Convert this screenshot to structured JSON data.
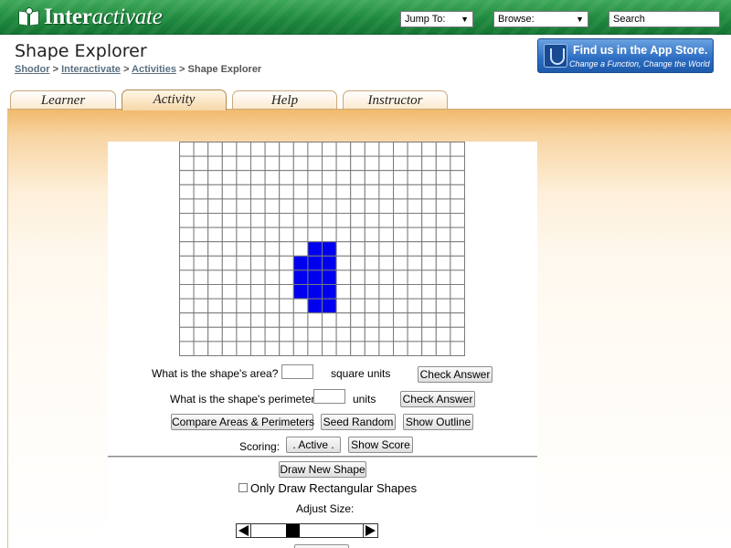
{
  "topbar": {
    "logo": {
      "part1": "Inter",
      "part2": "activate"
    },
    "jump_to": "Jump To:",
    "browse": "Browse:",
    "search_placeholder": "Search"
  },
  "header": {
    "title": "Shape Explorer",
    "breadcrumb": [
      "Shodor",
      "Interactivate",
      "Activities",
      "Shape Explorer"
    ],
    "breadcrumb_sep": ">",
    "appstore_line1": "Find us in the App Store.",
    "appstore_line2": "Change a Function, Change the World"
  },
  "tabs": [
    {
      "label": "Learner",
      "active": false
    },
    {
      "label": "Activity",
      "active": true
    },
    {
      "label": "Help",
      "active": false
    },
    {
      "label": "Instructor",
      "active": false
    }
  ],
  "grid": {
    "columns": 20,
    "rows": 15,
    "fill_color": "#0000ee",
    "filled_cells": [
      [
        9,
        7
      ],
      [
        10,
        7
      ],
      [
        8,
        8
      ],
      [
        9,
        8
      ],
      [
        10,
        8
      ],
      [
        8,
        9
      ],
      [
        9,
        9
      ],
      [
        10,
        9
      ],
      [
        8,
        10
      ],
      [
        9,
        10
      ],
      [
        10,
        10
      ],
      [
        9,
        11
      ],
      [
        10,
        11
      ]
    ]
  },
  "questions": {
    "area_label": "What is the shape's area?",
    "area_units": "square units",
    "perimeter_label": "What is the shape's perimeter?",
    "perimeter_units": "units",
    "check_answer": "Check Answer"
  },
  "buttons": {
    "compare": "Compare Areas & Perimeters",
    "seed_random": "Seed Random",
    "show_outline": "Show Outline",
    "scoring_label": "Scoring:",
    "active": ". Active .",
    "show_score": "Show Score",
    "draw_new": "Draw New Shape"
  },
  "options": {
    "rect_only": "Only Draw Rectangular Shapes",
    "adjust_size": "Adjust Size:",
    "size_level": 0.35
  },
  "colors": {
    "topbar_green": "#1f8a3e",
    "tab_border": "#c9a979",
    "content_orange": "#f1ba6c"
  }
}
